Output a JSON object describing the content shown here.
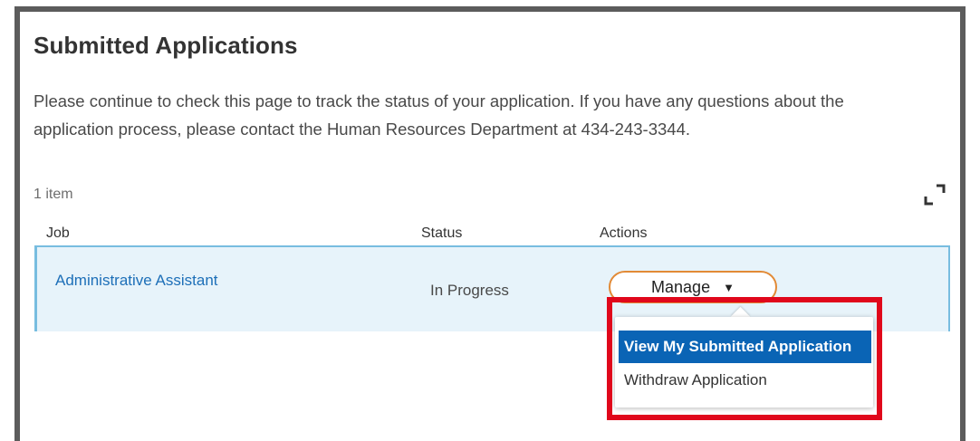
{
  "header": {
    "title": "Submitted Applications",
    "description": "Please continue to check this page to track the status of your application. If you have any questions about the application process, please contact the Human Resources Department at 434-243-3344."
  },
  "table": {
    "item_count": "1 item",
    "columns": [
      "Job",
      "Status",
      "Actions"
    ],
    "rows": [
      {
        "job": "Administrative Assistant",
        "status": "In Progress",
        "action_label": "Manage"
      }
    ]
  },
  "manage_menu": {
    "items": [
      "View My Submitted Application",
      "Withdraw Application"
    ],
    "selected_index": 0
  },
  "colors": {
    "accent_orange": "#e28a36",
    "link_blue": "#1d6fb8",
    "selected_blue": "#0a64b5",
    "row_highlight": "#e7f3fa",
    "annotation_red": "#e0071b"
  },
  "icons": {
    "expand": "expand-icon",
    "dropdown": "caret-down-icon"
  }
}
